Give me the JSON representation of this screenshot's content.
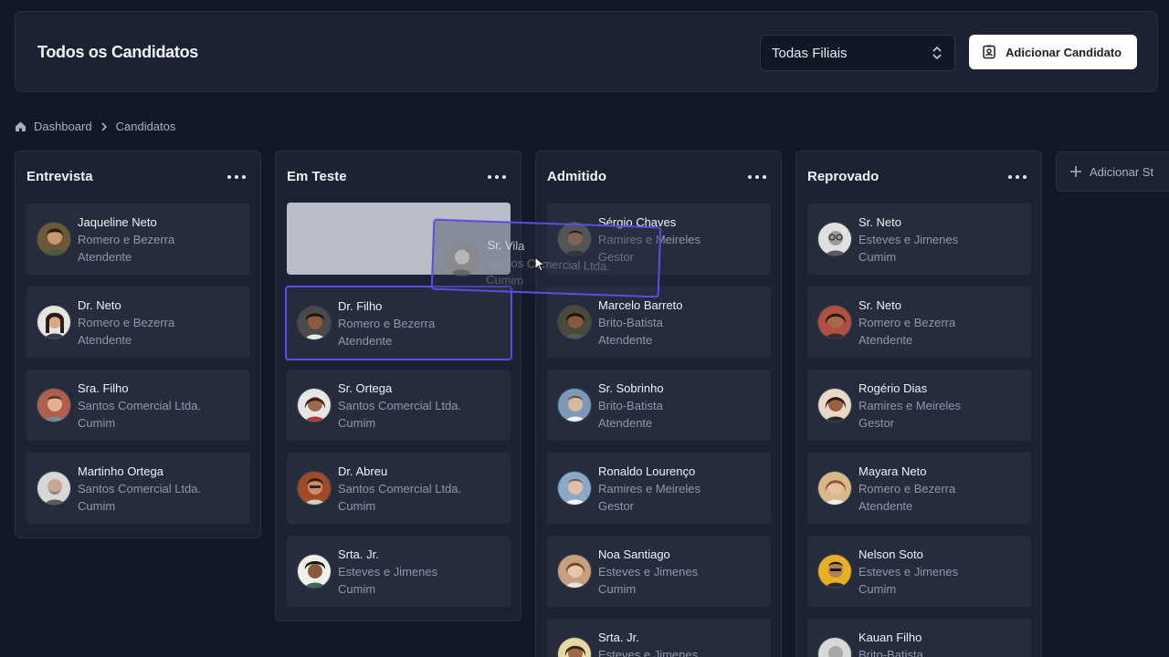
{
  "header": {
    "title": "Todos os Candidatos",
    "filter_value": "Todas Filiais",
    "add_button_label": "Adicionar Candidato"
  },
  "breadcrumb": [
    "Dashboard",
    "Candidatos"
  ],
  "add_stage_label": "Adicionar St",
  "columns": [
    {
      "title": "Entrevista",
      "cards": [
        {
          "name": "Jaqueline Neto",
          "company": "Romero e Bezerra",
          "role": "Atendente"
        },
        {
          "name": "Dr. Neto",
          "company": "Romero e Bezerra",
          "role": "Atendente"
        },
        {
          "name": "Sra. Filho",
          "company": "Santos Comercial Ltda.",
          "role": "Cumim"
        },
        {
          "name": "Martinho Ortega",
          "company": "Santos Comercial Ltda.",
          "role": "Cumim"
        }
      ]
    },
    {
      "title": "Em Teste",
      "cards": [
        {
          "name": "Dr. Filho",
          "company": "Romero e Bezerra",
          "role": "Atendente"
        },
        {
          "name": "Sr. Ortega",
          "company": "Santos Comercial Ltda.",
          "role": "Cumim"
        },
        {
          "name": "Dr. Abreu",
          "company": "Santos Comercial Ltda.",
          "role": "Cumim"
        },
        {
          "name": "Srta. Jr.",
          "company": "Esteves e Jimenes",
          "role": "Cumim"
        }
      ]
    },
    {
      "title": "Admitido",
      "cards": [
        {
          "name": "Sérgio Chaves",
          "company": "Ramires e Meireles",
          "role": "Gestor"
        },
        {
          "name": "Marcelo Barreto",
          "company": "Brito-Batista",
          "role": "Atendente"
        },
        {
          "name": "Sr. Sobrinho",
          "company": "Brito-Batista",
          "role": "Atendente"
        },
        {
          "name": "Ronaldo Lourenço",
          "company": "Ramires e Meireles",
          "role": "Gestor"
        },
        {
          "name": "Noa Santiago",
          "company": "Esteves e Jimenes",
          "role": "Cumim"
        },
        {
          "name": "Srta. Jr.",
          "company": "Esteves e Jimenes",
          "role": ""
        }
      ]
    },
    {
      "title": "Reprovado",
      "cards": [
        {
          "name": "Sr. Neto",
          "company": "Esteves e Jimenes",
          "role": "Cumim"
        },
        {
          "name": "Sr. Neto",
          "company": "Romero e Bezerra",
          "role": "Atendente"
        },
        {
          "name": "Rogério Dias",
          "company": "Ramires e Meireles",
          "role": "Gestor"
        },
        {
          "name": "Mayara Neto",
          "company": "Romero e Bezerra",
          "role": "Atendente"
        },
        {
          "name": "Nelson Soto",
          "company": "Esteves e Jimenes",
          "role": "Cumim"
        },
        {
          "name": "Kauan Filho",
          "company": "Brito-Batista",
          "role": ""
        }
      ]
    }
  ],
  "dragging_card": {
    "name": "Sr. Vila",
    "company": "Santos Comercial Ltda.",
    "role": "Cumim"
  },
  "colors": {
    "accent": "#5a4fe0",
    "background": "#121826",
    "card": "#252d3d"
  }
}
